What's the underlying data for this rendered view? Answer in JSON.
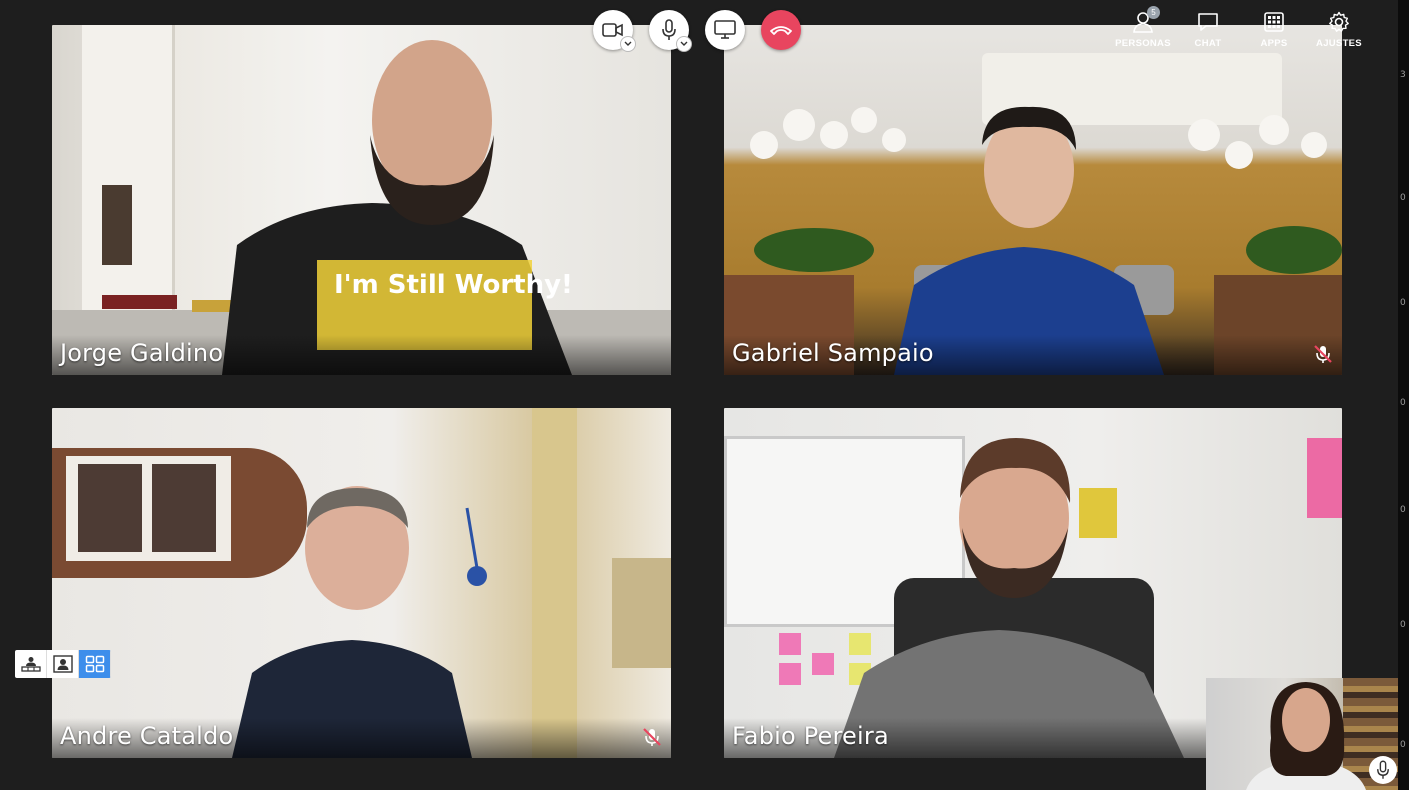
{
  "controls": {
    "camera": "camera-icon",
    "microphone": "microphone-icon",
    "screen_share": "monitor-icon",
    "hangup": "phone-hangup-icon",
    "hangup_color": "#e8455f"
  },
  "top_menu": {
    "people": {
      "label": "PERSONAS",
      "count": "5"
    },
    "chat": {
      "label": "CHAT"
    },
    "apps": {
      "label": "APPS"
    },
    "settings": {
      "label": "AJUSTES"
    }
  },
  "participants": [
    {
      "name": "Jorge Galdino",
      "muted": false
    },
    {
      "name": "Gabriel Sampaio",
      "muted": true
    },
    {
      "name": "Andre Cataldo",
      "muted": true
    },
    {
      "name": "Fabio Pereira",
      "muted": false
    }
  ],
  "layout_switcher": {
    "options": [
      "presenter-layout-icon",
      "speaker-layout-icon",
      "grid-layout-icon"
    ],
    "active": "grid-layout-icon",
    "active_color": "#3d8eeb"
  },
  "self_view": {
    "mic": "microphone-icon"
  },
  "side_ticks": [
    "3",
    "0",
    "0",
    "0",
    "0",
    "0",
    "0"
  ]
}
